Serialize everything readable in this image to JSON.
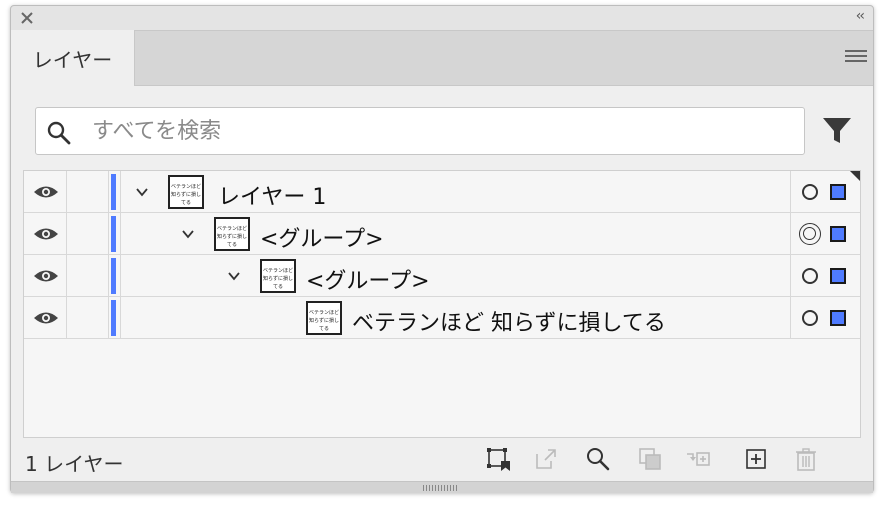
{
  "panel": {
    "tab_label": "レイヤー",
    "collapse_glyph": "‹‹"
  },
  "search": {
    "placeholder": "すべてを検索",
    "value": ""
  },
  "layers": [
    {
      "name": "レイヤー 1",
      "thumb_text": "ベテランほど知らずに損してる",
      "expanded": true
    },
    {
      "name": "<グループ>",
      "thumb_text": "ベテランほど知らずに損してる",
      "expanded": true
    },
    {
      "name": "<グループ>",
      "thumb_text": "ベテランほど知らずに損してる",
      "expanded": true
    },
    {
      "name": "ベテランほど 知らずに損してる",
      "thumb_text": "ベテランほど知らずに損してる"
    }
  ],
  "footer": {
    "layer_count": "1 レイヤー"
  },
  "colors": {
    "layer_color": "#4f7bff",
    "panel_bg": "#e4e4e4",
    "list_bg": "#f6f6f6"
  },
  "icons": {
    "visibility": "eye-icon",
    "expand": "chevron-down-icon",
    "filter": "filter-icon",
    "search": "search-icon",
    "menu": "hamburger-menu-icon",
    "close": "close-icon"
  }
}
